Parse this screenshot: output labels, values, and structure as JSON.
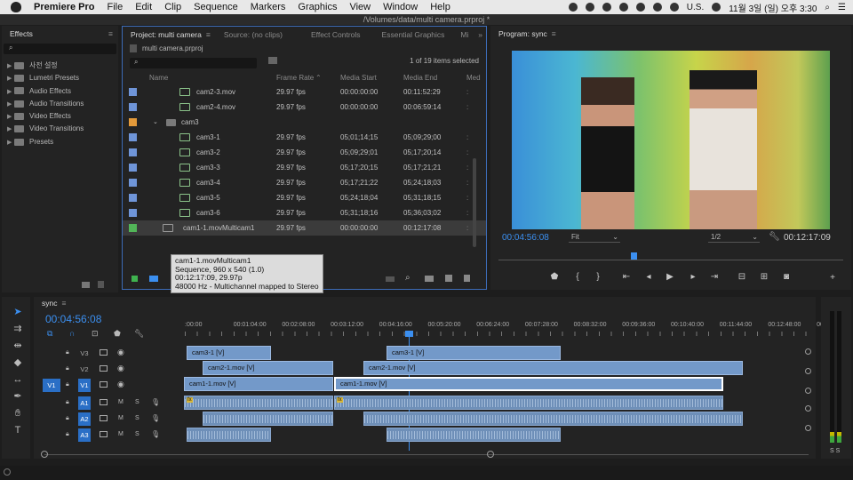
{
  "menubar": {
    "app": "Premiere Pro",
    "items": [
      "File",
      "Edit",
      "Clip",
      "Sequence",
      "Markers",
      "Graphics",
      "View",
      "Window",
      "Help"
    ],
    "locale": "U.S.",
    "datetime": "11월 3일 (일) 오후 3:30"
  },
  "window_title": "/Volumes/data/multi camera.prproj *",
  "effects": {
    "tab": "Effects",
    "items": [
      "사전 설정",
      "Lumetri Presets",
      "Audio Effects",
      "Audio Transitions",
      "Video Effects",
      "Video Transitions",
      "Presets"
    ]
  },
  "project": {
    "tabs": [
      "Project: multi camera",
      "Source: (no clips)",
      "Effect Controls",
      "Essential Graphics",
      "Mi"
    ],
    "file": "multi camera.prproj",
    "count": "1 of 19 items selected",
    "columns": [
      "Name",
      "Frame Rate",
      "Media Start",
      "Media End",
      "Med"
    ],
    "rows": [
      {
        "name": "cam2-3.mov",
        "rate": "29.97 fps",
        "start": "00:00:00:00",
        "end": "00:11:52:29",
        "color": "#6f95d8",
        "type": "clip"
      },
      {
        "name": "cam2-4.mov",
        "rate": "29.97 fps",
        "start": "00:00:00:00",
        "end": "00:06:59:14",
        "color": "#6f95d8",
        "type": "clip"
      },
      {
        "name": "cam3",
        "rate": "",
        "start": "",
        "end": "",
        "color": "#e39a3a",
        "type": "bin"
      },
      {
        "name": "cam3-1",
        "rate": "29.97 fps",
        "start": "05;01;14;15",
        "end": "05;09;29;00",
        "color": "#6f95d8",
        "type": "clip"
      },
      {
        "name": "cam3-2",
        "rate": "29.97 fps",
        "start": "05;09;29;01",
        "end": "05;17;20;14",
        "color": "#6f95d8",
        "type": "clip"
      },
      {
        "name": "cam3-3",
        "rate": "29.97 fps",
        "start": "05;17;20;15",
        "end": "05;17;21;21",
        "color": "#6f95d8",
        "type": "clip"
      },
      {
        "name": "cam3-4",
        "rate": "29.97 fps",
        "start": "05;17;21;22",
        "end": "05;24;18;03",
        "color": "#6f95d8",
        "type": "clip"
      },
      {
        "name": "cam3-5",
        "rate": "29.97 fps",
        "start": "05;24;18;04",
        "end": "05;31;18;15",
        "color": "#6f95d8",
        "type": "clip"
      },
      {
        "name": "cam3-6",
        "rate": "29.97 fps",
        "start": "05;31;18;16",
        "end": "05;36;03;02",
        "color": "#6f95d8",
        "type": "clip"
      },
      {
        "name": "cam1-1.movMulticam1",
        "rate": "29.97 fps",
        "start": "00:00:00:00",
        "end": "00:12:17:08",
        "color": "#52b558",
        "type": "seq"
      }
    ],
    "tooltip": [
      "cam1-1.movMulticam1",
      "Sequence, 960 x 540 (1.0)",
      "00:12:17:09, 29.97p",
      "48000 Hz - Multichannel mapped to Stereo"
    ]
  },
  "program": {
    "tab": "Program: sync",
    "timecode": "00:04:56:08",
    "fit": "Fit",
    "res": "1/2",
    "duration": "00:12:17:09"
  },
  "timeline": {
    "tab": "sync",
    "timecode": "00:04:56:08",
    "ruler": [
      ":00:00",
      "00:01:04:00",
      "00:02:08:00",
      "00:03:12:00",
      "00:04:16:00",
      "00:05:20:00",
      "00:06:24:00",
      "00:07:28:00",
      "00:08:32:00",
      "00:09:36:00",
      "00:10:40:00",
      "00:11:44:00",
      "00:12:48:00",
      "00:"
    ],
    "tracks": [
      "V3",
      "V2",
      "V1",
      "A1",
      "A2",
      "A3"
    ],
    "src_v": "V1",
    "clips_v3": [
      "cam3-1 [V]",
      "cam3-1 [V]"
    ],
    "clips_v2": [
      "cam2-1.mov [V]",
      "cam2-1.mov [V]"
    ],
    "clips_v1": [
      "cam1-1.mov [V]",
      "cam1-1.mov [V]"
    ],
    "m": "M",
    "s": "S",
    "meter": "S S",
    "fx": "fx"
  }
}
